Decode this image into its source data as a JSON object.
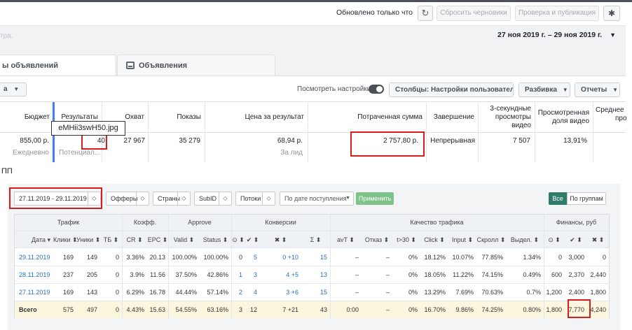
{
  "fb": {
    "status": "Обновлено только что",
    "discard_label": "Сбросить черновики",
    "review_label": "Проверка и публикация",
    "faded_text": "тра.",
    "date_range": "27 ноя 2019 г. – 29 ноя 2019 г.",
    "tab_adsets_label": "ы объявлений",
    "tab_ads_label": "Объявления",
    "left_select": "а",
    "preview_label": "Посмотреть настройки",
    "columns_label": "Столбцы: Настройки пользовател",
    "breakdown_label": "Разбивка",
    "reports_label": "Отчеты",
    "headers": {
      "budget": "Бюджет",
      "results": "Результаты",
      "reach": "Охват",
      "impressions": "Показы",
      "cost_per_result": "Цена за результат",
      "amount_spent": "Потраченная сумма",
      "ends": "Завершение",
      "views3s": "3-секундные просмотры видео",
      "watched": "Просмотренная доля видео",
      "avg": "Среднее",
      "avg2": "про"
    },
    "row": {
      "budget": "855,00 р.",
      "budget_type": "Ежедневно",
      "results": "40",
      "results_sub": "Потенциал...",
      "reach": "27 967",
      "impressions": "35 279",
      "cost_per_result": "68,94 р.",
      "cost_sub": "За лид",
      "amount_spent": "2 757,80 р.",
      "ends": "Непрерывная",
      "views3s": "7 507",
      "watched": "13,91%"
    },
    "tooltip": "eMHii3swH50.jpg"
  },
  "pp_label": "ПП",
  "tracker": {
    "date_range": "27.11.2019 - 29.11.2019",
    "offers": "Офферы",
    "countries": "Страны",
    "subid": "SubID",
    "streams": "Потоки",
    "by_date": "По дате поступления",
    "apply": "Применить",
    "all": "Все",
    "by_groups": "По группам",
    "groups": {
      "traffic": "Трафик",
      "coef": "Коэфф.",
      "approve": "Approve",
      "conversions": "Конверсии",
      "quality": "Качество трафика",
      "finance": "Финансы, руб"
    },
    "columns": [
      "Дата ▾",
      "Клики ⬍",
      "Уники ⬍",
      "ТБ ⬍",
      "CR ⬍",
      "EPC ⬍",
      "Valid ⬍",
      "Status ⬍",
      "⊙ ⬍",
      "✔ ⬍",
      "✖ ⬍",
      "Σ ⬍",
      "avT ⬍",
      "Отказ ⬍",
      "t>30 ⬍",
      "Click ⬍",
      "Input ⬍",
      "Скролл ⬍",
      "Выдел. ⬍",
      "⊙ ⬍",
      "✔ ⬍",
      "✖ ⬍"
    ],
    "rows": [
      [
        "29.11.2019",
        "169",
        "149",
        "0",
        "3.36%",
        "20.13",
        "100.00%",
        "100.00%",
        "0",
        "5",
        "0 +10",
        "15",
        "–",
        "–",
        "0%",
        "18.12%",
        "10.07%",
        "77.85%",
        "1.34%",
        "0",
        "3,000",
        "0"
      ],
      [
        "28.11.2019",
        "237",
        "205",
        "0",
        "3.9%",
        "11.56",
        "37.50%",
        "42.86%",
        "1",
        "3",
        "4 +5",
        "13",
        "–",
        "–",
        "0%",
        "18.05%",
        "11.22%",
        "74.15%",
        "0.49%",
        "600",
        "2,370",
        "2,440"
      ],
      [
        "27.11.2019",
        "169",
        "143",
        "0",
        "6.29%",
        "16.78",
        "44.44%",
        "57.14%",
        "2",
        "4",
        "3 +6",
        "15",
        "–",
        "–",
        "0%",
        "13.29%",
        "7.69%",
        "70.63%",
        "0.7%",
        "1,200",
        "2,400",
        "1,800"
      ],
      [
        "Всего",
        "575",
        "497",
        "0",
        "4.43%",
        "15.63",
        "54.55%",
        "63.16%",
        "3",
        "12",
        "7 +21",
        "43",
        "0:00",
        "–",
        "0%",
        "16.70%",
        "9.86%",
        "74.25%",
        "0.80%",
        "1,800",
        "7,770",
        "4,240"
      ]
    ]
  }
}
